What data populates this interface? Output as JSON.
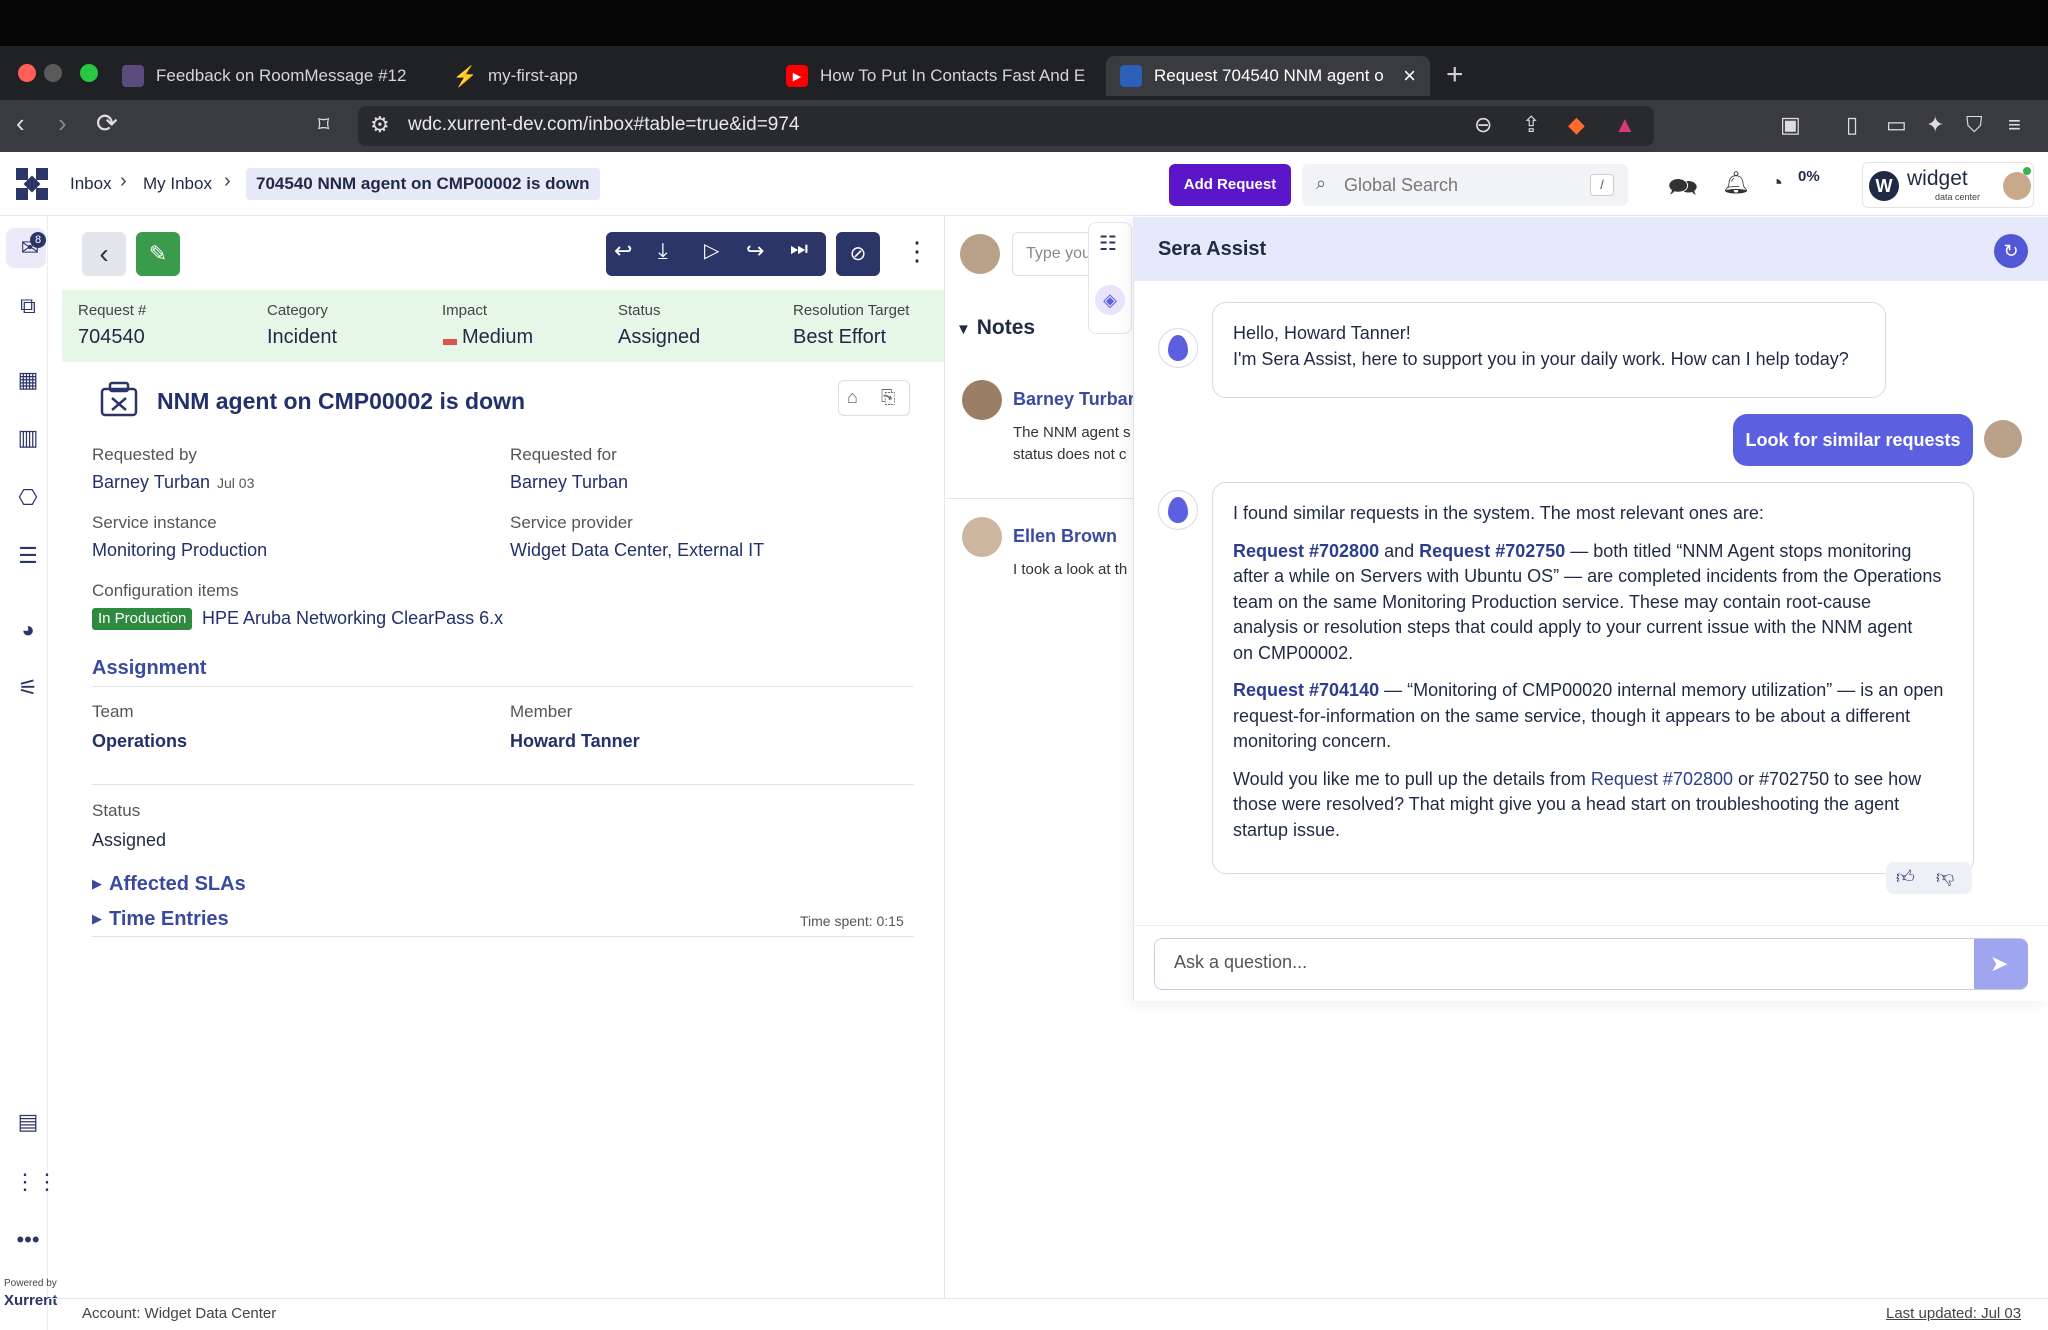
{
  "browser": {
    "tabs": [
      {
        "label": "Feedback on RoomMessage #12"
      },
      {
        "label": "my-first-app"
      },
      {
        "label": "How To Put In Contacts Fast And E"
      },
      {
        "label": "Request 704540 NNM agent o"
      }
    ],
    "url": "wdc.xurrent-dev.com/inbox#table=true&id=974"
  },
  "header": {
    "breadcrumb": [
      "Inbox",
      "My Inbox"
    ],
    "current": "704540  NNM agent on CMP00002 is down",
    "add_request": "Add Request",
    "search_placeholder": "Global Search",
    "search_key": "/",
    "timer_pct": "0%",
    "brand_name": "widget",
    "brand_sub": "data center"
  },
  "rail": {
    "inbox_badge": "8",
    "powered_by": "Powered by",
    "vendor": "Xurrent"
  },
  "request": {
    "fields": [
      {
        "label": "Request #",
        "value": "704540"
      },
      {
        "label": "Category",
        "value": "Incident"
      },
      {
        "label": "Impact",
        "value": "Medium"
      },
      {
        "label": "Status",
        "value": "Assigned"
      },
      {
        "label": "Resolution Target",
        "value": "Best Effort"
      }
    ],
    "title": "NNM agent on CMP00002 is down",
    "requested_by_label": "Requested by",
    "requested_by": "Barney Turban",
    "requested_by_date": "Jul 03",
    "requested_for_label": "Requested for",
    "requested_for": "Barney Turban",
    "service_instance_label": "Service instance",
    "service_instance": "Monitoring Production",
    "service_provider_label": "Service provider",
    "service_provider": "Widget Data Center, External IT",
    "ci_label": "Configuration items",
    "ci_badge": "In Production",
    "ci_value": "HPE Aruba Networking ClearPass 6.x",
    "assignment_heading": "Assignment",
    "team_label": "Team",
    "team": "Operations",
    "member_label": "Member",
    "member": "Howard Tanner",
    "status_label": "Status",
    "status": "Assigned",
    "affected_slas": "Affected SLAs",
    "time_entries": "Time Entries",
    "time_spent": "Time spent: 0:15"
  },
  "notes": {
    "input_placeholder": "Type you",
    "heading": "Notes",
    "items": [
      {
        "author": "Barney Turban",
        "line1": "The NNM agent s",
        "line2": "status does not c"
      },
      {
        "author": "Ellen Brown",
        "line1": "I took a look at th"
      }
    ]
  },
  "sera": {
    "title": "Sera Assist",
    "greeting_line1": "Hello, Howard Tanner!",
    "greeting_line2": "I'm Sera Assist, here to support you in your daily work. How can I help today?",
    "user_message": "Look for similar requests",
    "reply_intro": "I found similar requests in the system. The most relevant ones are:",
    "ref_a": "Request #702800",
    "and_word": "and",
    "ref_b": "Request #702750",
    "p2_line1_rest": "— both titled “NNM Agent stops monitoring",
    "p2_line2": "after a while on Servers with Ubuntu OS” — are completed incidents from the Operations",
    "p2_line3": "team on the same Monitoring Production service. These may contain root-cause",
    "p2_line4": "analysis or resolution steps that could apply to your current issue with the NNM agent",
    "p2_line5": "on CMP00002.",
    "ref_c": "Request #704140",
    "p3_line1_rest": "— “Monitoring of CMP00020 internal memory utilization” — is an open",
    "p3_line2": "request-for-information on the same service, though it appears to be about a different",
    "p3_line3": "monitoring concern.",
    "p4_pre": "Would you like me to pull up the details from",
    "ref_d": "Request #702800",
    "p4_post": "or #702750 to see how",
    "p4_line2": "those were resolved? That might give you a head start on troubleshooting the agent",
    "p4_line3": "startup issue.",
    "input_placeholder": "Ask a question..."
  },
  "footer": {
    "account": "Account: Widget Data Center",
    "updated": "Last updated: Jul 03"
  }
}
